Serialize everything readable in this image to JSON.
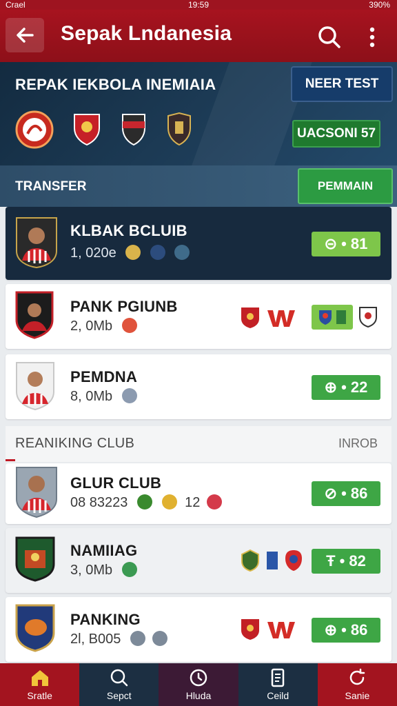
{
  "status_bar": {
    "carrier": "Crael",
    "time": "19:59",
    "battery": "390%"
  },
  "app_bar": {
    "title": "Sepak Lndanesia"
  },
  "hero": {
    "title": "REPAK IEKBOLA INEMIAIA",
    "button": "NEER TEST",
    "badge": "UACSONI 57"
  },
  "transfer": {
    "label": "TRANSFER",
    "button": "PEMMAIN"
  },
  "transfer_cards": [
    {
      "name": "KLBAK BCLUIB",
      "sub": "1, 020e",
      "score_symbol": "⊝",
      "score_value": "• 81"
    },
    {
      "name": "PANK PGIUNB",
      "sub": "2, 0Mb",
      "score_symbol": "",
      "score_value": ""
    },
    {
      "name": "PEMDNA",
      "sub": "8, 0Mb",
      "score_symbol": "⊕",
      "score_value": "• 22"
    }
  ],
  "ranking": {
    "title": "REANIKING CLUB",
    "link": "INROB"
  },
  "ranking_cards": [
    {
      "name": "GLUR CLUB",
      "sub": "08 83223",
      "sub_extra": "12",
      "score_symbol": "⊘",
      "score_value": "• 86"
    },
    {
      "name": "NAMIIAG",
      "sub": "3, 0Mb",
      "score_symbol": "Ŧ",
      "score_value": "• 82"
    },
    {
      "name": "PANKING",
      "sub": "2l, B005",
      "score_symbol": "⊕",
      "score_value": "• 86"
    }
  ],
  "nav": [
    {
      "label": "Sratle",
      "icon": "home-icon"
    },
    {
      "label": "Sepct",
      "icon": "search-icon"
    },
    {
      "label": "Hluda",
      "icon": "clock-icon"
    },
    {
      "label": "Ceild",
      "icon": "document-icon"
    },
    {
      "label": "Sanie",
      "icon": "refresh-icon"
    }
  ],
  "colors": {
    "primary_red": "#a7131f",
    "navy": "#172a3e",
    "green": "#3ea645",
    "lime": "#7ec64a"
  }
}
